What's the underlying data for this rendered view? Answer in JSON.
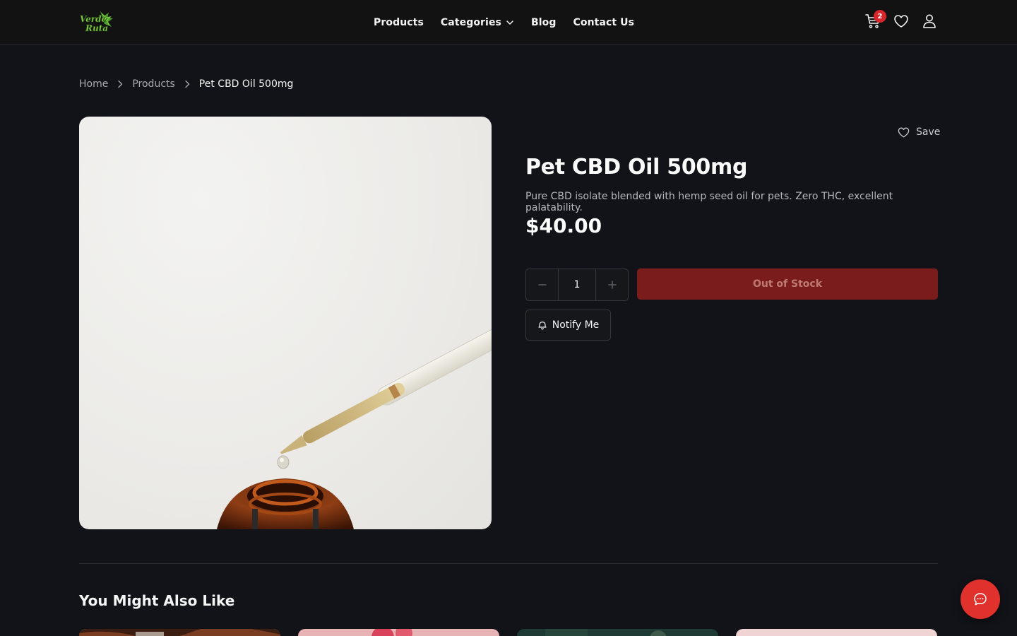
{
  "header": {
    "logo_text": "Verde Ruta",
    "nav": [
      {
        "label": "Products",
        "icon": null
      },
      {
        "label": "Categories",
        "icon": "chevron-down-icon"
      },
      {
        "label": "Blog",
        "icon": null
      },
      {
        "label": "Contact Us",
        "icon": null
      }
    ],
    "cart_count": "2",
    "icons": [
      "cart-icon",
      "heart-icon",
      "user-icon"
    ]
  },
  "breadcrumb": {
    "items": [
      "Home",
      "Products",
      "Pet CBD Oil 500mg"
    ],
    "separator_icon": "chevron-right-icon"
  },
  "product": {
    "save_label": "Save",
    "title": "Pet CBD Oil 500mg",
    "description": "Pure CBD isolate blended with hemp seed oil for pets. Zero THC, excellent palatability.",
    "price": "$40.00",
    "quantity": "1",
    "out_of_stock_label": "Out of Stock",
    "notify_label": "Notify Me",
    "image_subject": "dropper over amber bottle"
  },
  "related": {
    "heading": "You Might Also Like",
    "cards": [
      "related-product-1",
      "related-product-2",
      "related-product-3",
      "related-product-4"
    ]
  },
  "colors": {
    "background": "#111318",
    "accent_red": "#e1312c",
    "out_of_stock_bg": "#7a1c1c",
    "badge_red": "#d9262b"
  },
  "chat": {
    "icon": "chat-bubble-icon"
  }
}
